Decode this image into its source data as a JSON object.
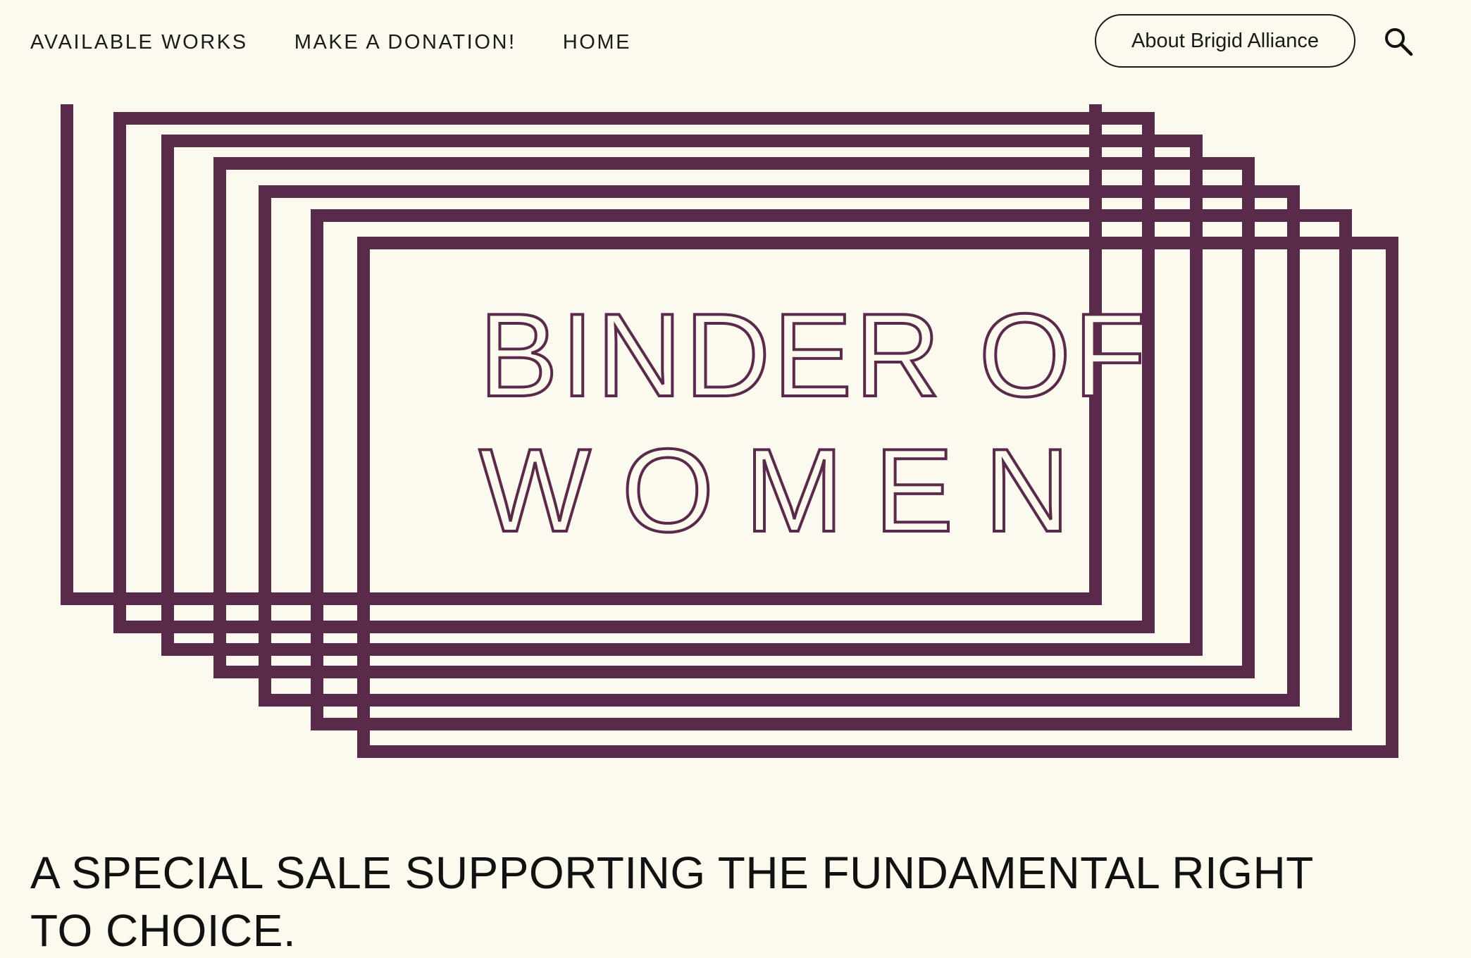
{
  "nav": {
    "links": [
      {
        "label": "AVAILABLE WORKS"
      },
      {
        "label": "MAKE A DONATION!"
      },
      {
        "label": "HOME"
      }
    ],
    "about_button": "About Brigid Alliance",
    "search_icon": "search-icon"
  },
  "hero": {
    "logo_line_1": "BINDER OF",
    "logo_line_2": "WOMEN",
    "logo_color": "#5a2a4a"
  },
  "main": {
    "headline": "A SPECIAL SALE SUPPORTING THE FUNDAMENTAL RIGHT TO CHOICE."
  },
  "colors": {
    "background": "#fcf9ee",
    "text": "#111111",
    "brand": "#5a2a4a"
  }
}
